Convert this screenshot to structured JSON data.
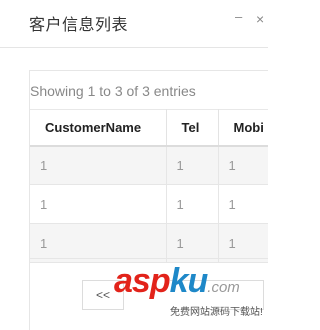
{
  "dialog": {
    "title": "客户信息列表",
    "minimize_symbol": "–",
    "close_symbol": "×"
  },
  "table": {
    "info": "Showing 1 to 3 of 3 entries",
    "columns": [
      "CustomerName",
      "Tel",
      "Mobi"
    ],
    "rows": [
      [
        "1",
        "1",
        "1"
      ],
      [
        "1",
        "1",
        "1"
      ],
      [
        "1",
        "1",
        "1"
      ]
    ]
  },
  "pagination": {
    "prev_label": "<<"
  },
  "watermark": {
    "brand_a": "asp",
    "brand_b": "ku",
    "domain": ".com",
    "slogan": "免费网站源码下载站!",
    "colors": {
      "asp": "#e2231a",
      "ku": "#1e88c8"
    }
  }
}
